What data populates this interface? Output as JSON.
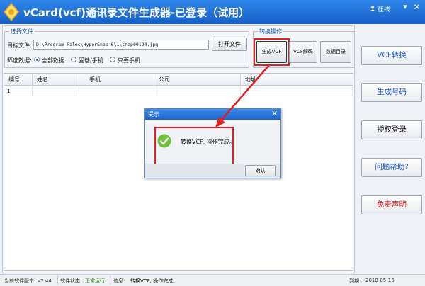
{
  "window": {
    "title": "vCard(vcf)通讯录文件生成器-已登录（试用）",
    "online_label": "在线",
    "minimize_glyph": "▾",
    "close_glyph": "✕"
  },
  "file_group": {
    "title": "选择文件",
    "target_label": "目标文件:",
    "path_value": "D:\\Program Files\\HyperSnap 6\\1\\snap00194.jpg",
    "open_button": "打开文件",
    "filter_label": "筛选数据:",
    "filter_options": [
      "全部数据",
      "固话/手机",
      "只要手机"
    ],
    "filter_selected": 0
  },
  "convert_group": {
    "title": "转换操作",
    "gen_vcf": "生成VCF",
    "vcf_decode": "VCF解码",
    "data_dir": "数据目录"
  },
  "table": {
    "columns": [
      "编号",
      "姓名",
      "手机",
      "公司",
      "地址"
    ],
    "rows": [
      [
        "1",
        "",
        "",
        "",
        ""
      ]
    ]
  },
  "side_buttons": [
    {
      "label": "VCF转换",
      "color": "#1a56c8"
    },
    {
      "label": "生成号码",
      "color": "#1a56c8"
    },
    {
      "label": "授权登录",
      "color": "#111111"
    },
    {
      "label": "问题帮助?",
      "color": "#1a56c8"
    },
    {
      "label": "免责声明",
      "color": "#e01818"
    }
  ],
  "dialog": {
    "title": "提示",
    "message": "转换VCF, 操作完成。",
    "ok_button": "确认"
  },
  "status": {
    "version_label": "当前软件版本: V2.44",
    "state_label": "软件状态:",
    "state_value": "正常运行",
    "info_label": "信息:",
    "info_value": "转换VCF, 操作完成。",
    "expire_label": "到期:",
    "expire_value": "2018-05-16"
  },
  "colors": {
    "accent_blue": "#1a56c8",
    "highlight_red": "#e02020",
    "running_green": "#1a8a1a"
  }
}
